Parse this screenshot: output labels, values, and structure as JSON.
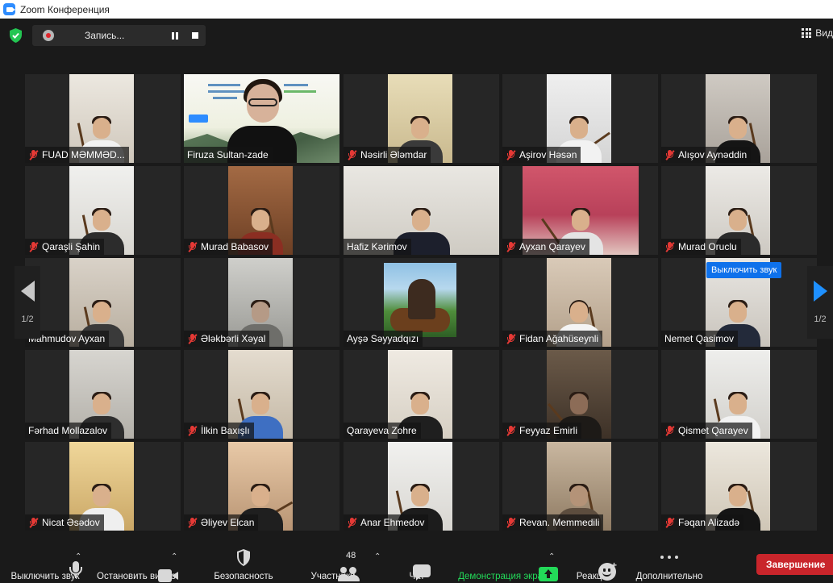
{
  "window": {
    "title": "Zoom Конференция"
  },
  "recording": {
    "label": "Запись..."
  },
  "view": {
    "label": "Вид"
  },
  "pagination": {
    "left": "1/2",
    "right": "1/2"
  },
  "tooltip": {
    "text": "Выключить звук"
  },
  "banner": {
    "zoom_tag": "ZOOM"
  },
  "participants": [
    {
      "name": "FUAD MƏMMƏD...",
      "muted": true
    },
    {
      "name": "Firuza Sultan-zade",
      "muted": false,
      "active": true
    },
    {
      "name": "Nəsirli Ələmdar",
      "muted": true
    },
    {
      "name": "Aşirov Həsən",
      "muted": true
    },
    {
      "name": "Alışov Aynəddin",
      "muted": true
    },
    {
      "name": "Qaraşli Şahin",
      "muted": true
    },
    {
      "name": "Murad Babasov",
      "muted": true
    },
    {
      "name": "Hafiz Kərimov",
      "muted": false
    },
    {
      "name": "Ayxan Qarayev",
      "muted": true
    },
    {
      "name": "Murad Oruclu",
      "muted": true
    },
    {
      "name": "Mahmudov Ayxan",
      "muted": false
    },
    {
      "name": "Ələkbərli Xəyal",
      "muted": true
    },
    {
      "name": "Ayşə Səyyadqızı",
      "muted": false
    },
    {
      "name": "Fidan Ağahüseynli",
      "muted": true
    },
    {
      "name": "Nemet Qasimov",
      "muted": false
    },
    {
      "name": "Fərhad Mollazalov",
      "muted": false
    },
    {
      "name": "İlkin Baxışlı",
      "muted": true
    },
    {
      "name": "Qarayeva Zohre",
      "muted": false
    },
    {
      "name": "Feyyaz Emirli",
      "muted": true
    },
    {
      "name": "Qismet Qarayev",
      "muted": true
    },
    {
      "name": "Nicat Əsədov",
      "muted": true
    },
    {
      "name": "Əliyev Elcan",
      "muted": true
    },
    {
      "name": "Anar Ehmedov",
      "muted": true
    },
    {
      "name": "Revan. Memmedili",
      "muted": true
    },
    {
      "name": "Fəqan Alizadə",
      "muted": true
    }
  ],
  "toolbar": {
    "mute_label": "Выключить звук",
    "video_label": "Остановить видео",
    "security_label": "Безопасность",
    "participants_label": "Участники",
    "participants_count": "48",
    "chat_label": "Чат",
    "share_label": "Демонстрация экрана",
    "reactions_label": "Реакции",
    "more_label": "Дополнительно",
    "end_label": "Завершение"
  },
  "colors": {
    "background": "#1a1a1a",
    "active_speaker": "#e3ec62",
    "share_green": "#23d959",
    "end_red": "#c9252b",
    "accent_blue": "#0e71eb"
  }
}
